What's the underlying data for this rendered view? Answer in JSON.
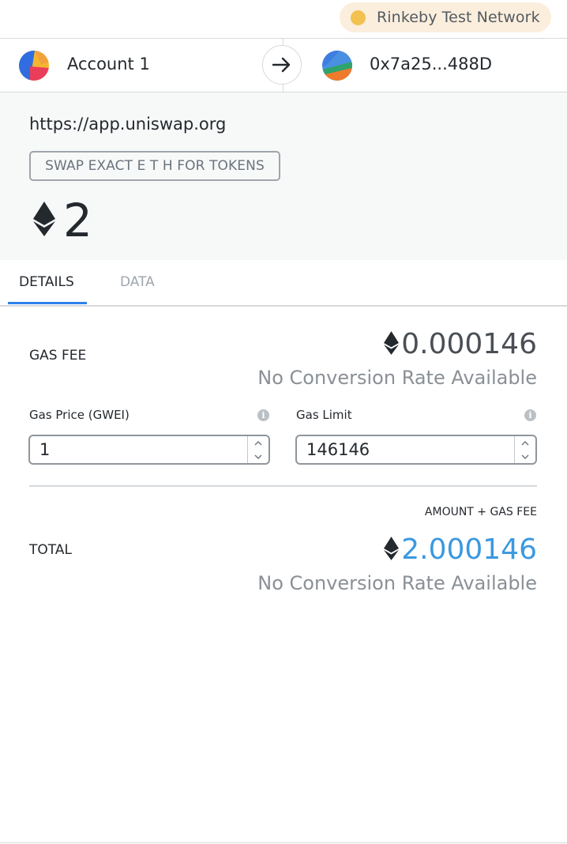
{
  "network": {
    "label": "Rinkeby Test Network",
    "dot_color": "#f2c14f"
  },
  "sender": {
    "name": "Account 1",
    "avatar_icon": "jazzicon-avatar"
  },
  "arrow_icon": "arrow-right-icon",
  "recipient": {
    "address": "0x7a25...488D",
    "avatar_icon": "jazzicon-avatar"
  },
  "transaction": {
    "origin": "https://app.uniswap.org",
    "method": "SWAP EXACT E T H FOR TOKENS",
    "amount": "2",
    "currency_icon": "ethereum-icon"
  },
  "tabs": [
    {
      "label": "DETAILS",
      "active": true
    },
    {
      "label": "DATA",
      "active": false
    }
  ],
  "details": {
    "gas_fee_label": "GAS FEE",
    "gas_fee_value": "0.000146",
    "gas_fee_conversion": "No Conversion Rate Available",
    "gas_price_label": "Gas Price (GWEI)",
    "gas_price_value": "1",
    "gas_limit_label": "Gas Limit",
    "gas_limit_value": "146146",
    "amount_gas_label": "AMOUNT + GAS FEE",
    "total_label": "TOTAL",
    "total_value": "2.000146",
    "total_conversion": "No Conversion Rate Available"
  },
  "colors": {
    "accent": "#2f80ed",
    "total": "#3b99e0",
    "network_pill": "#fbeedd"
  }
}
